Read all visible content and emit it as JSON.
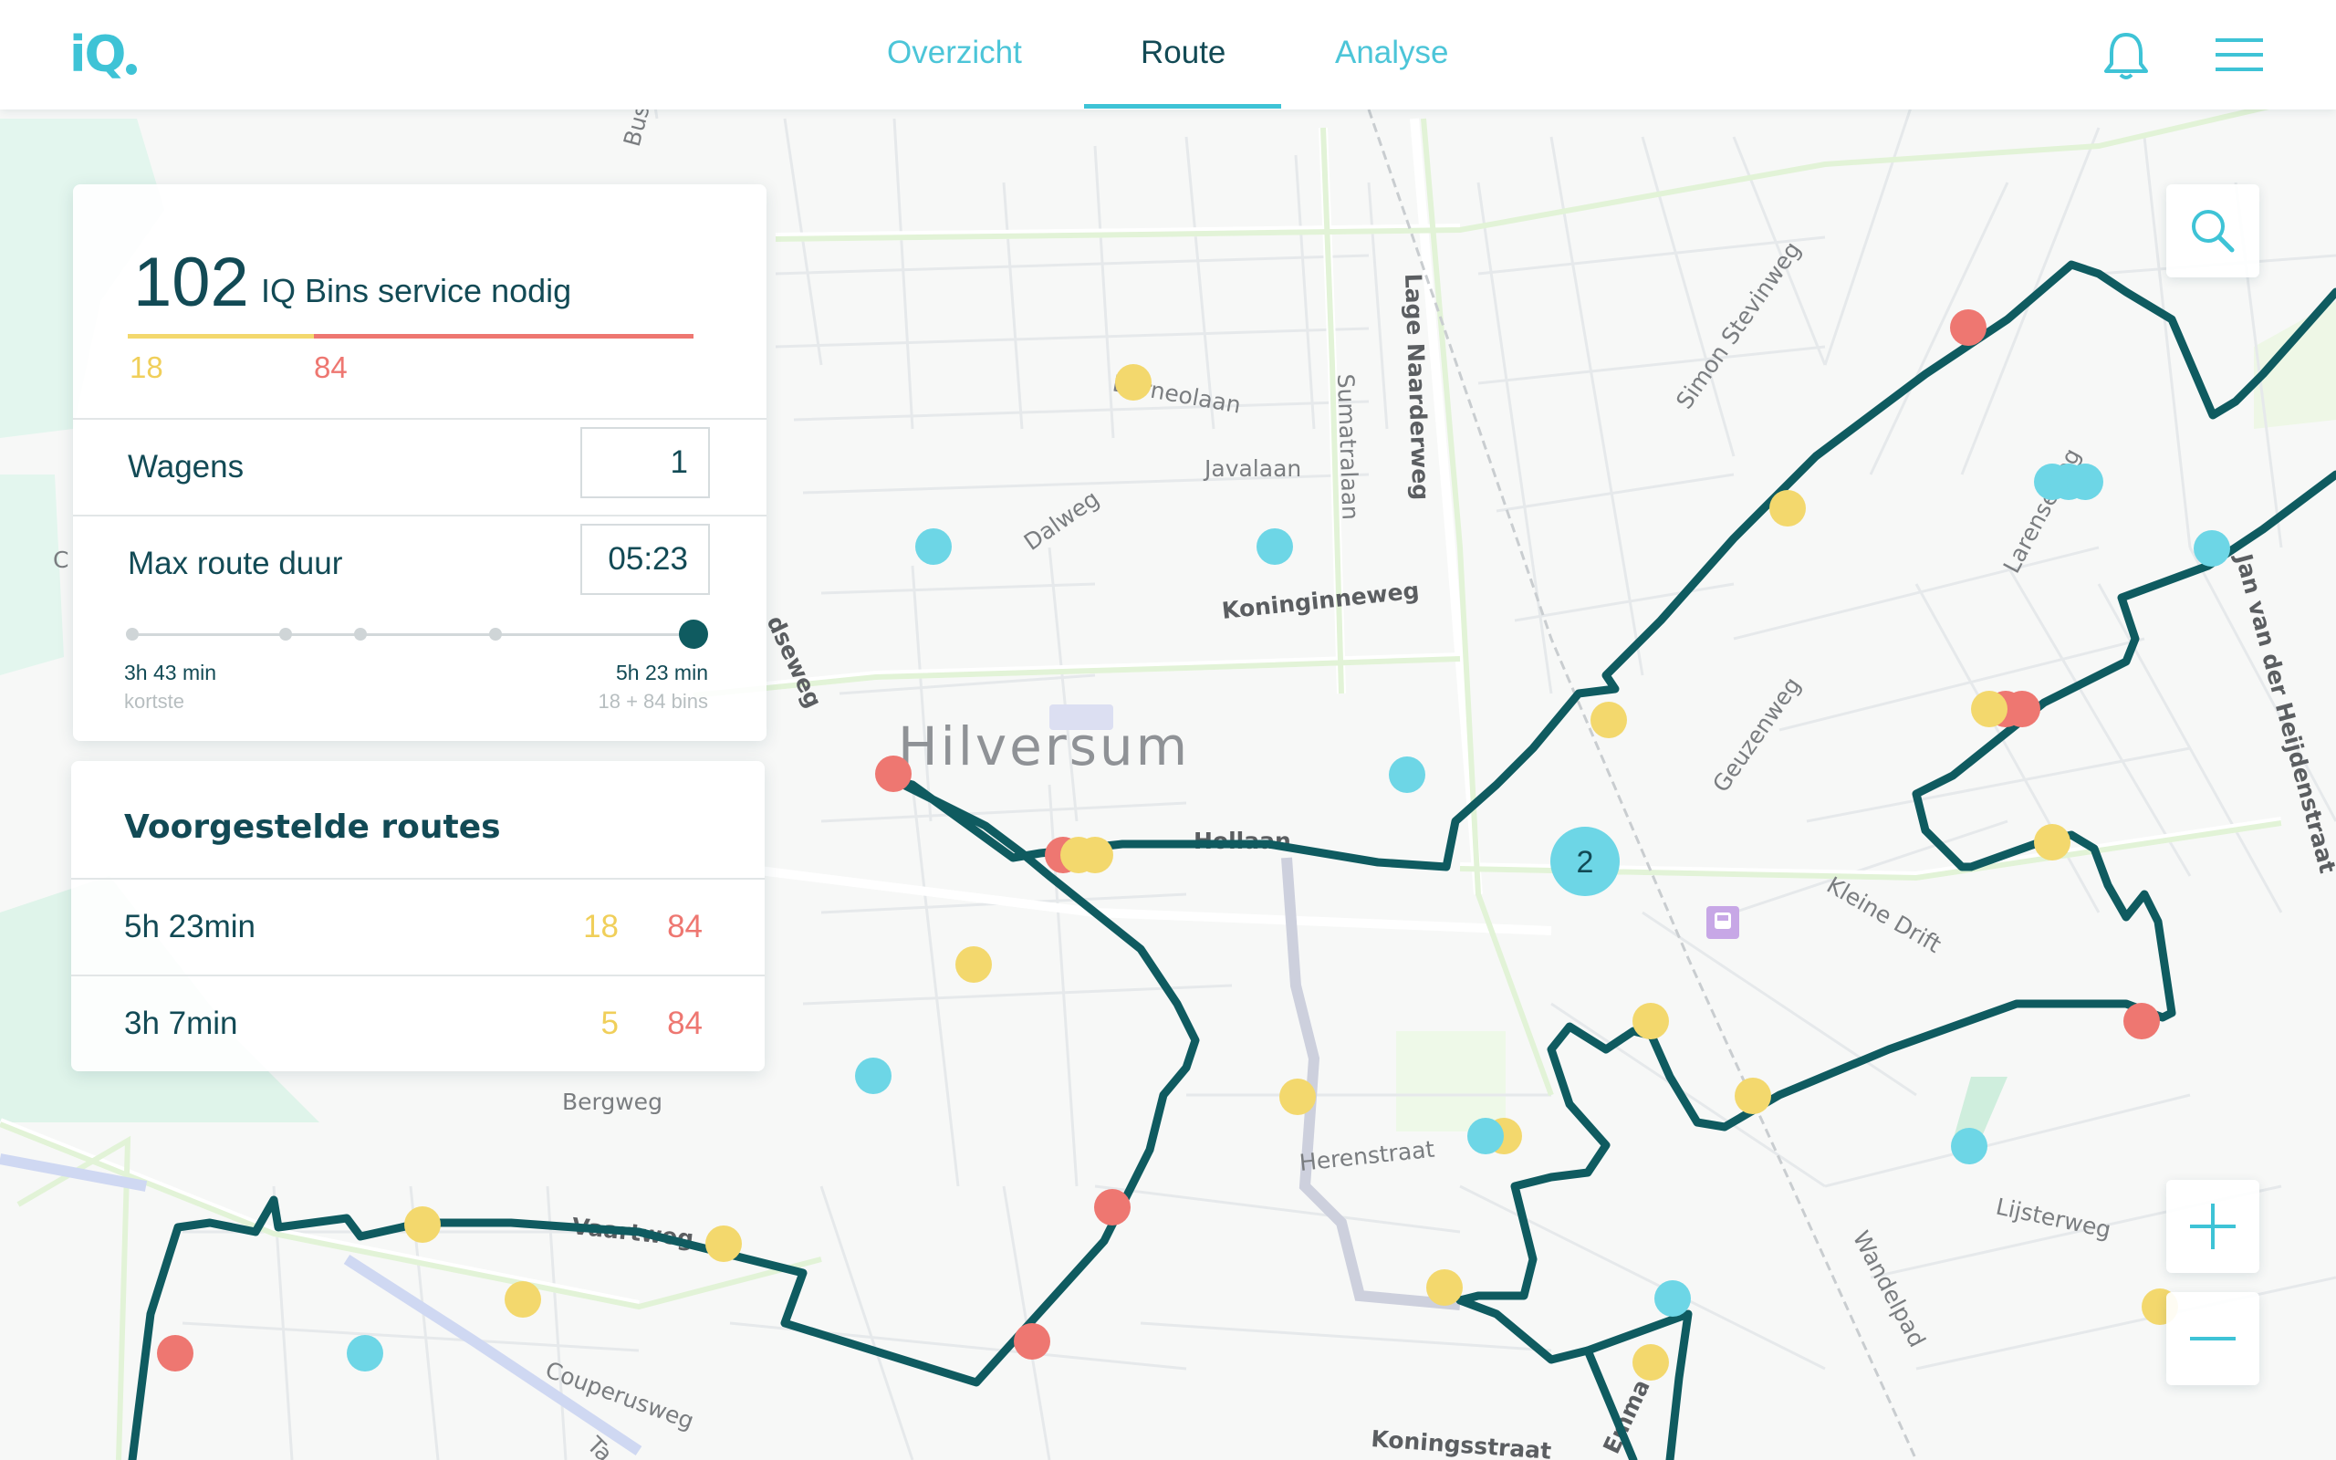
{
  "app": {
    "logo": "iQ"
  },
  "nav": {
    "tabs": [
      {
        "label": "Overzicht",
        "active": false
      },
      {
        "label": "Route",
        "active": true
      },
      {
        "label": "Analyse",
        "active": false
      }
    ],
    "icons": [
      "bell-icon",
      "hamburger-menu-icon"
    ]
  },
  "summary": {
    "count": "102",
    "label": "IQ Bins service nodig",
    "yellow_count": "18",
    "red_count": "84",
    "wagens_label": "Wagens",
    "wagens_value": "1",
    "max_duur_label": "Max route duur",
    "max_duur_value": "05:23",
    "slider": {
      "min_label": "3h 43 min",
      "min_sub": "kortste",
      "max_label": "5h 23 min",
      "max_sub": "18 + 84 bins",
      "value_fraction": 1.0
    }
  },
  "routes": {
    "title": "Voorgestelde routes",
    "items": [
      {
        "duration": "5h 23min",
        "yellow": "18",
        "red": "84"
      },
      {
        "duration": "3h 7min",
        "yellow": "5",
        "red": "84"
      }
    ]
  },
  "map": {
    "city": "Hilversum",
    "cluster_count": "2",
    "street_labels": {
      "lage_naarderweg": "Lage Naarderweg",
      "sumatralaan": "Sumatralaan",
      "simon_stevinweg": "Simon Stevinweg",
      "javalaan": "Javalaan",
      "borneolaan": "Borneolaan",
      "dalweg": "Dalweg",
      "koninginneweg": "Koninginneweg",
      "larenseweg": "Larenseweg",
      "jan_van_der_heijdenstraat": "Jan van der Heijdenstraat",
      "geuzenweg": "Geuzenweg",
      "kleine_drift": "Kleine Drift",
      "hoflaan": "Hollaan",
      "bergweg": "Bergweg",
      "herenstraat": "Herenstraat",
      "lijsterweg": "Lijsterweg",
      "wandelpad": "Wandelpad",
      "vaartweg": "Vaartweg",
      "couperusweg": "Couperusweg",
      "koningsstraat": "Koningsstraat",
      "emmastraat": "Emma",
      "busstation": "Bus",
      "loosdrechtseweg": "dseweg",
      "talmalaan": "Ta",
      "corvers": "C"
    },
    "colors": {
      "route": "#0f5b60",
      "red": "#ee7771",
      "yellow": "#f3d86d",
      "cyan": "#6dd6e6"
    },
    "controls": [
      "search-icon",
      "zoom-in-icon",
      "zoom-out-icon"
    ]
  }
}
